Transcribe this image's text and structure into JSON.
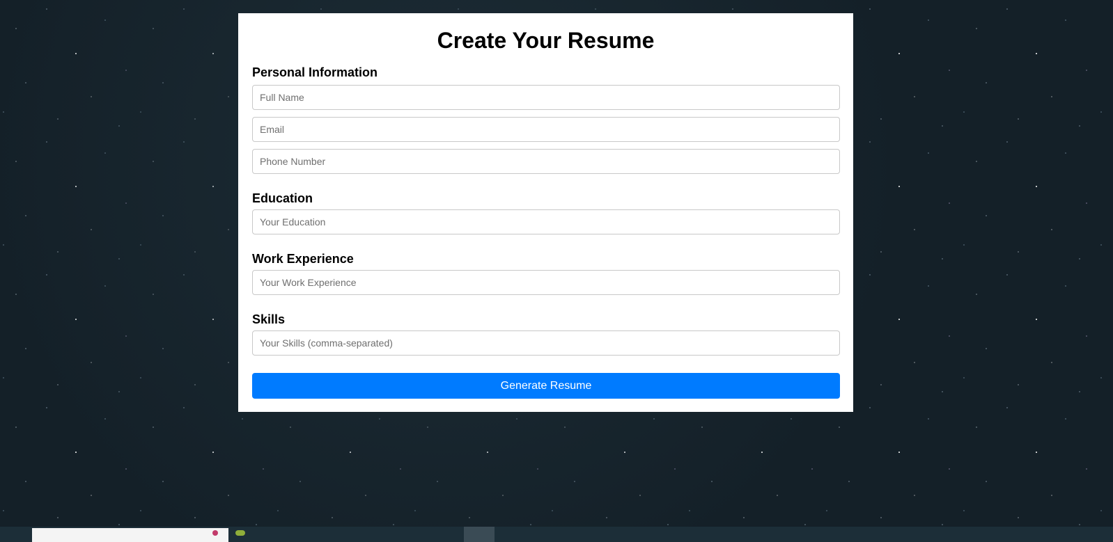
{
  "form": {
    "title": "Create Your Resume",
    "sections": {
      "personal": {
        "heading": "Personal Information",
        "full_name": {
          "placeholder": "Full Name",
          "value": ""
        },
        "email": {
          "placeholder": "Email",
          "value": ""
        },
        "phone": {
          "placeholder": "Phone Number",
          "value": ""
        }
      },
      "education": {
        "heading": "Education",
        "input": {
          "placeholder": "Your Education",
          "value": ""
        }
      },
      "work": {
        "heading": "Work Experience",
        "input": {
          "placeholder": "Your Work Experience",
          "value": ""
        }
      },
      "skills": {
        "heading": "Skills",
        "input": {
          "placeholder": "Your Skills (comma-separated)",
          "value": ""
        }
      }
    },
    "submit_label": "Generate Resume"
  },
  "colors": {
    "primary_button": "#007bff",
    "panel_background": "#ffffff",
    "page_background": "#142028"
  }
}
